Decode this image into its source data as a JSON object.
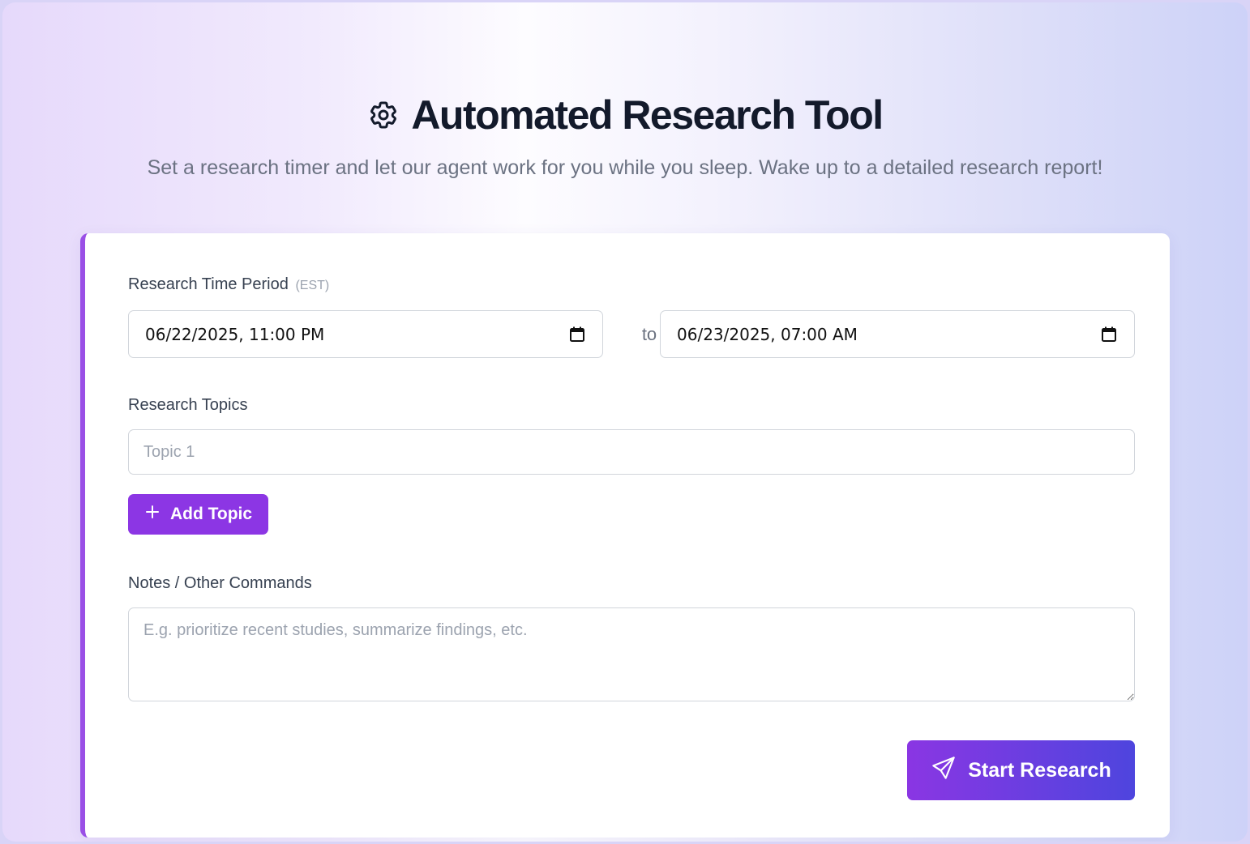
{
  "header": {
    "title": "Automated Research Tool",
    "subtitle": "Set a research timer and let our agent work for you while you sleep. Wake up to a detailed research report!",
    "icon": "gear-icon"
  },
  "form": {
    "time_period": {
      "label": "Research Time Period",
      "timezone": "(EST)",
      "start_value": "06/22/2025, 11:00 PM",
      "separator": "to",
      "end_value": "06/23/2025, 07:00 AM"
    },
    "topics": {
      "label": "Research Topics",
      "placeholder": "Topic 1",
      "value": "",
      "add_label": "Add Topic"
    },
    "notes": {
      "label": "Notes / Other Commands",
      "placeholder": "E.g. prioritize recent studies, summarize findings, etc.",
      "value": ""
    },
    "submit_label": "Start Research"
  },
  "colors": {
    "accent": "#8c36e4",
    "accent_end": "#4e45de",
    "title": "#131a2b",
    "muted": "#6b7282"
  }
}
